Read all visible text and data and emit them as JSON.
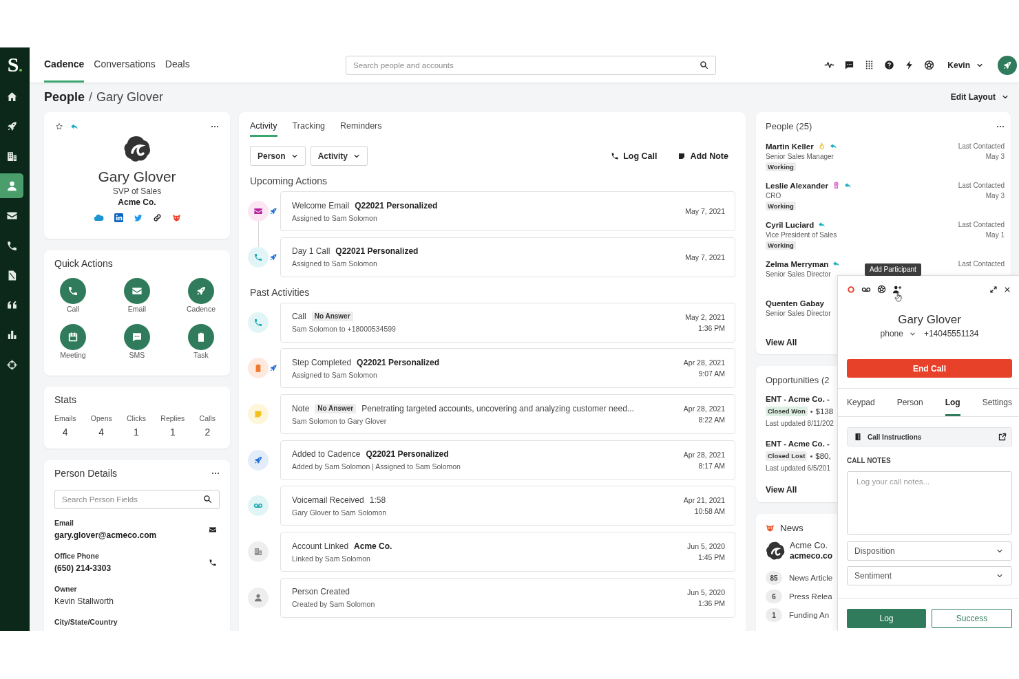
{
  "sidebar": {
    "logo": "S",
    "items": [
      {
        "kind": "home",
        "selected": false
      },
      {
        "kind": "cadence",
        "selected": false
      },
      {
        "kind": "accounts",
        "selected": false
      },
      {
        "kind": "people",
        "selected": true
      },
      {
        "kind": "email",
        "selected": false
      },
      {
        "kind": "calls",
        "selected": false
      },
      {
        "kind": "documents",
        "selected": false
      },
      {
        "kind": "quotes",
        "selected": false
      },
      {
        "kind": "analytics",
        "selected": false
      },
      {
        "kind": "targets",
        "selected": false
      }
    ]
  },
  "header": {
    "tabs": [
      {
        "label": "Cadence",
        "selected": true
      },
      {
        "label": "Conversations",
        "selected": false
      },
      {
        "label": "Deals",
        "selected": false
      }
    ],
    "search": {
      "placeholder": "Search people and accounts"
    },
    "user": "Kevin"
  },
  "breadcrumb": {
    "section": "People",
    "separator": "/",
    "current": "Gary Glover"
  },
  "edit_layout": "Edit Layout",
  "profile": {
    "starred": false,
    "replied": true,
    "name": "Gary Glover",
    "title": "SVP of Sales",
    "company": "Acme Co."
  },
  "quick_actions": {
    "title": "Quick Actions",
    "actions": [
      {
        "kind": "call",
        "label": "Call"
      },
      {
        "kind": "email",
        "label": "Email"
      },
      {
        "kind": "cadence",
        "label": "Cadence"
      },
      {
        "kind": "meeting",
        "label": "Meeting"
      },
      {
        "kind": "sms",
        "label": "SMS"
      },
      {
        "kind": "task",
        "label": "Task"
      }
    ]
  },
  "stats": {
    "title": "Stats",
    "items": [
      {
        "label": "Emails",
        "value": "4"
      },
      {
        "label": "Opens",
        "value": "4"
      },
      {
        "label": "Clicks",
        "value": "1"
      },
      {
        "label": "Replies",
        "value": "1"
      },
      {
        "label": "Calls",
        "value": "2"
      }
    ]
  },
  "person_details": {
    "title": "Person Details",
    "search": {
      "placeholder": "Search Person Fields"
    },
    "fields": [
      {
        "kind": "email",
        "label": "Email",
        "value": "gary.glover@acmeco.com"
      },
      {
        "kind": "phone",
        "label": "Office Phone",
        "value": "(650) 214-3303"
      },
      {
        "kind": "text",
        "label": "Owner",
        "value": "Kevin Stallworth"
      },
      {
        "kind": "text",
        "label": "City/State/Country"
      }
    ]
  },
  "activity": {
    "tabs": [
      {
        "label": "Activity",
        "selected": true
      },
      {
        "label": "Tracking",
        "selected": false
      },
      {
        "label": "Reminders",
        "selected": false
      }
    ],
    "filters": [
      "Person",
      "Activity"
    ],
    "actions": [
      {
        "kind": "call",
        "label": "Log Call"
      },
      {
        "kind": "note",
        "label": "Add Note"
      }
    ],
    "sections": [
      {
        "kind": "upcoming",
        "title": "Upcoming Actions",
        "items": [
          {
            "kind": "email",
            "cadence": true,
            "title": "Welcome Email",
            "detail": "Q22021 Personalized",
            "subtitle": "Assigned to Sam Solomon",
            "date": "May 7, 2021"
          },
          {
            "kind": "call",
            "cadence": true,
            "title": "Day 1 Call",
            "detail": "Q22021 Personalized",
            "subtitle": "Assigned to Sam Solomon",
            "date": "May 7, 2021"
          }
        ]
      },
      {
        "kind": "past",
        "title": "Past Activities",
        "items": [
          {
            "kind": "call",
            "cadence": false,
            "title": "Call",
            "badge": "No Answer",
            "subtitle": "Sam Solomon to +18000534599",
            "date": "May 2, 2021",
            "time": "1:36 PM"
          },
          {
            "kind": "task",
            "cadence": true,
            "title": "Step Completed",
            "detail": "Q22021 Personalized",
            "subtitle": "Assigned to Sam Solomon",
            "date": "Apr 28, 2021",
            "time": "9:07 AM"
          },
          {
            "kind": "note",
            "cadence": false,
            "title": "Note",
            "badge": "No Answer",
            "text": "Penetrating targeted accounts, uncovering and analyzing customer need...",
            "subtitle": "Sam Solomon to Gary Glover",
            "date": "Apr 28, 2021",
            "time": "8:22 AM"
          },
          {
            "kind": "cadence",
            "cadence": false,
            "title": "Added to Cadence",
            "detail": "Q22021 Personalized",
            "subtitle": "Added by Sam Solomon | Assigned to Sam Solomon",
            "date": "Apr 28, 2021",
            "time": "8:17 AM"
          },
          {
            "kind": "voicemail",
            "cadence": false,
            "title": "Voicemail Received",
            "text": "1:58",
            "subtitle": "Gary Glover to Sam Solomon",
            "date": "Apr 21, 2021",
            "time": "10:58 AM"
          },
          {
            "kind": "account",
            "cadence": false,
            "title": "Account Linked",
            "detail": "Acme Co.",
            "subtitle": "Linked by Sam Solomon",
            "date": "Jun 5, 2020",
            "time": "1:45 PM"
          },
          {
            "kind": "person",
            "cadence": false,
            "title": "Person Created",
            "subtitle": "Created by Sam Solomon",
            "date": "Jun 5, 2020",
            "time": "1:36 PM"
          }
        ]
      }
    ]
  },
  "people": {
    "title": "People (25)",
    "items": [
      {
        "name": "Martin Keller",
        "hot": true,
        "award": false,
        "replied": true,
        "title": "Senior Sales Manager",
        "status": "Working",
        "contacted_label": "Last Contacted",
        "contacted": "May 3"
      },
      {
        "name": "Leslie Alexander",
        "hot": false,
        "award": true,
        "replied": true,
        "title": "CRO",
        "status": "Working",
        "contacted_label": "Last Contacted",
        "contacted": "May 3"
      },
      {
        "name": "Cyril Luciard",
        "hot": false,
        "award": false,
        "replied": true,
        "title": "Vice President of Sales",
        "status": "Working",
        "contacted_label": "Last Contacted",
        "contacted": "May 1"
      },
      {
        "name": "Zelma Merryman",
        "hot": false,
        "award": false,
        "replied": true,
        "title": "Senior Sales Director",
        "contacted_label": "Last Contacted"
      },
      {
        "name": "Quenten Gabay",
        "hot": false,
        "award": false,
        "replied": false,
        "title": "Senior Sales Director"
      }
    ],
    "view_all": "View All"
  },
  "opportunities": {
    "title": "Opportunities (2",
    "items": [
      {
        "name": "ENT - Acme Co. -",
        "stage": "Closed Won",
        "color": "#dcefe2",
        "separator": "•",
        "amount": "$138",
        "updated": "Last updated 8/11/202"
      },
      {
        "name": "ENT - Acme Co. -",
        "stage": "Closed Lost",
        "color": "#ececec",
        "separator": "•",
        "amount": "$80,",
        "updated": "Last updated 6/5/201"
      }
    ],
    "view_all": "View All"
  },
  "news": {
    "title": "News",
    "company": "Acme Co.",
    "domain": "acmeco.co",
    "counts": [
      {
        "count": "85",
        "label": "News Article"
      },
      {
        "count": "6",
        "label": "Press Relea"
      },
      {
        "count": "1",
        "label": "Funding An"
      }
    ]
  },
  "dialer": {
    "tooltip": "Add Participant",
    "name": "Gary Glover",
    "phone_type": "phone",
    "phone": "+14045551134",
    "end_call": "End Call",
    "tabs": [
      {
        "label": "Keypad",
        "selected": false
      },
      {
        "label": "Person",
        "selected": false
      },
      {
        "label": "Log",
        "selected": true
      },
      {
        "label": "Settings",
        "selected": false
      }
    ],
    "instructions": "Call Instructions",
    "notes_label": "CALL NOTES",
    "notes": {
      "placeholder": "Log your call notes..."
    },
    "selects": [
      {
        "placeholder": "Disposition"
      },
      {
        "placeholder": "Sentiment"
      }
    ],
    "buttons": [
      {
        "kind": "primary",
        "label": "Log"
      },
      {
        "kind": "secondary",
        "label": "Success"
      }
    ]
  }
}
